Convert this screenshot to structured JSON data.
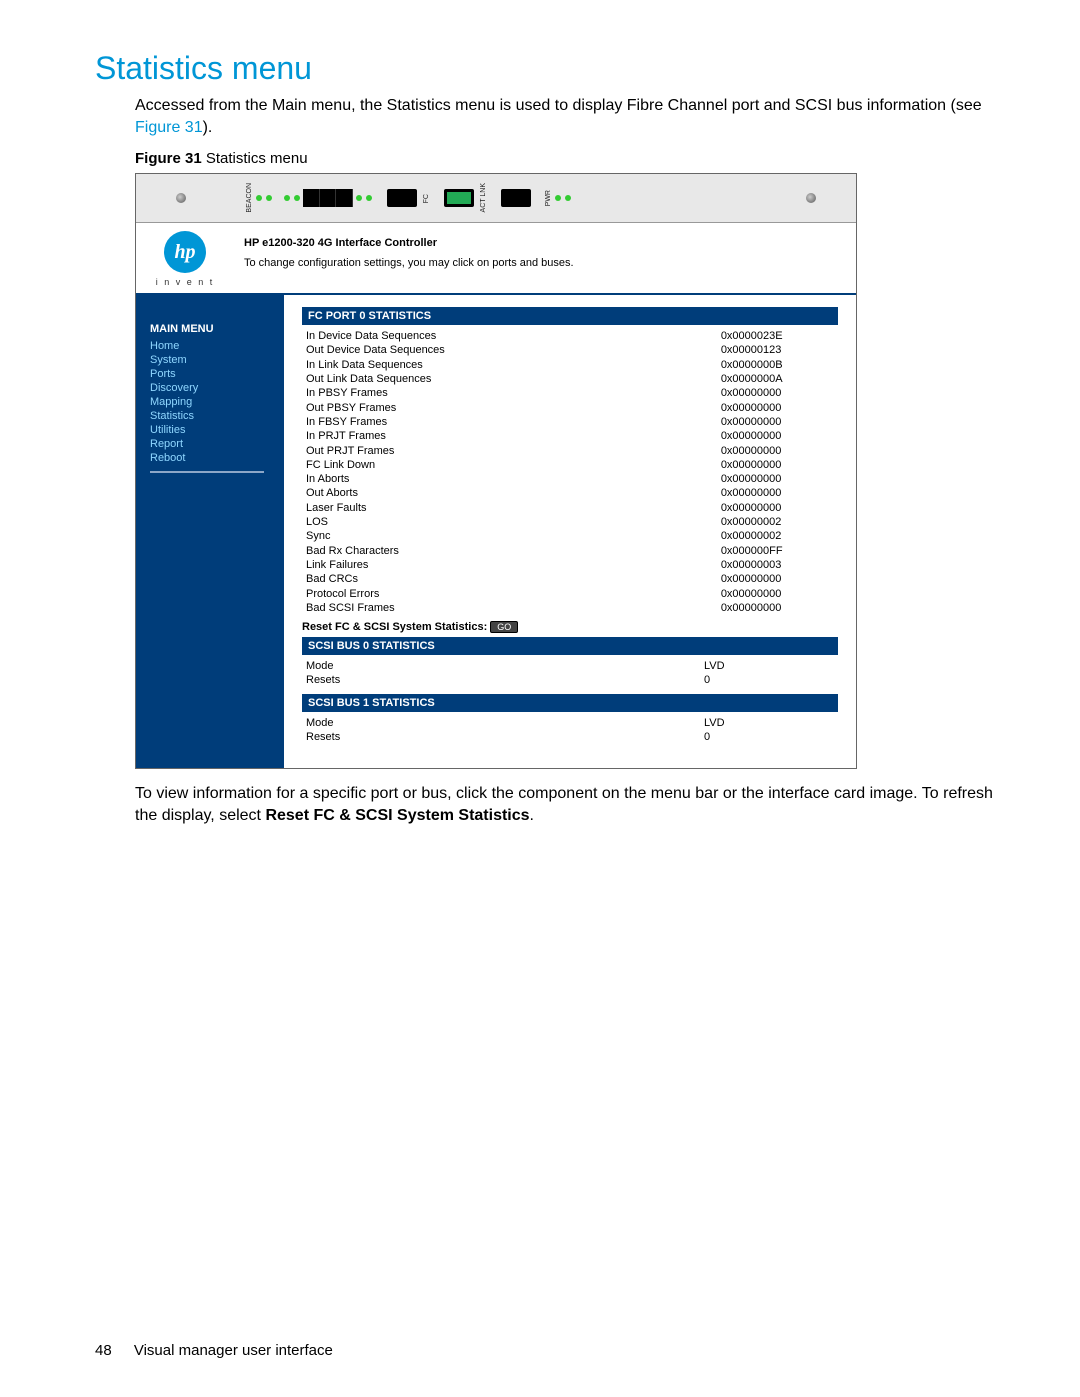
{
  "page_number": "48",
  "footer_text": "Visual manager user interface",
  "section_title": "Statistics menu",
  "intro_text_1": "Accessed from the Main menu, the Statistics menu is used to display Fibre Channel port and SCSI bus information (see ",
  "intro_link": "Figure 31",
  "intro_text_2": ").",
  "figure_label": "Figure 31",
  "figure_caption": " Statistics menu",
  "outro_text_1": "To view information for a specific port or bus, click the component on the menu bar or the interface card image. To refresh the display, select ",
  "outro_bold": "Reset FC & SCSI System Statistics",
  "outro_text_2": ".",
  "app": {
    "product_name": "HP e1200-320 4G Interface Controller",
    "subtitle": "To change configuration settings, you may click on ports and buses.",
    "logo_text": "hp",
    "invent": "i n v e n t",
    "sidebar": {
      "title": "MAIN MENU",
      "items": [
        "Home",
        "System",
        "Ports",
        "Discovery",
        "Mapping",
        "Statistics",
        "Utilities",
        "Report",
        "Reboot"
      ]
    },
    "sections": [
      {
        "title": "FC PORT 0 STATISTICS",
        "rows": [
          [
            "In Device Data Sequences",
            "0x0000023E"
          ],
          [
            "Out Device Data Sequences",
            "0x00000123"
          ],
          [
            "In Link Data Sequences",
            "0x0000000B"
          ],
          [
            "Out Link Data Sequences",
            "0x0000000A"
          ],
          [
            "In PBSY Frames",
            "0x00000000"
          ],
          [
            "Out PBSY Frames",
            "0x00000000"
          ],
          [
            "In FBSY Frames",
            "0x00000000"
          ],
          [
            "In PRJT Frames",
            "0x00000000"
          ],
          [
            "Out PRJT Frames",
            "0x00000000"
          ],
          [
            "FC Link Down",
            "0x00000000"
          ],
          [
            "In Aborts",
            "0x00000000"
          ],
          [
            "Out Aborts",
            "0x00000000"
          ],
          [
            "Laser Faults",
            "0x00000000"
          ],
          [
            "LOS",
            "0x00000002"
          ],
          [
            "Sync",
            "0x00000002"
          ],
          [
            "Bad Rx Characters",
            "0x000000FF"
          ],
          [
            "Link Failures",
            "0x00000003"
          ],
          [
            "Bad CRCs",
            "0x00000000"
          ],
          [
            "Protocol Errors",
            "0x00000000"
          ],
          [
            "Bad SCSI Frames",
            "0x00000000"
          ]
        ],
        "reset_label": "Reset FC & SCSI System Statistics:",
        "go": "GO"
      },
      {
        "title": "SCSI BUS 0 STATISTICS",
        "rows": [
          [
            "Mode",
            "LVD"
          ],
          [
            "Resets",
            "0"
          ]
        ]
      },
      {
        "title": "SCSI BUS 1 STATISTICS",
        "rows": [
          [
            "Mode",
            "LVD"
          ],
          [
            "Resets",
            "0"
          ]
        ]
      }
    ]
  }
}
